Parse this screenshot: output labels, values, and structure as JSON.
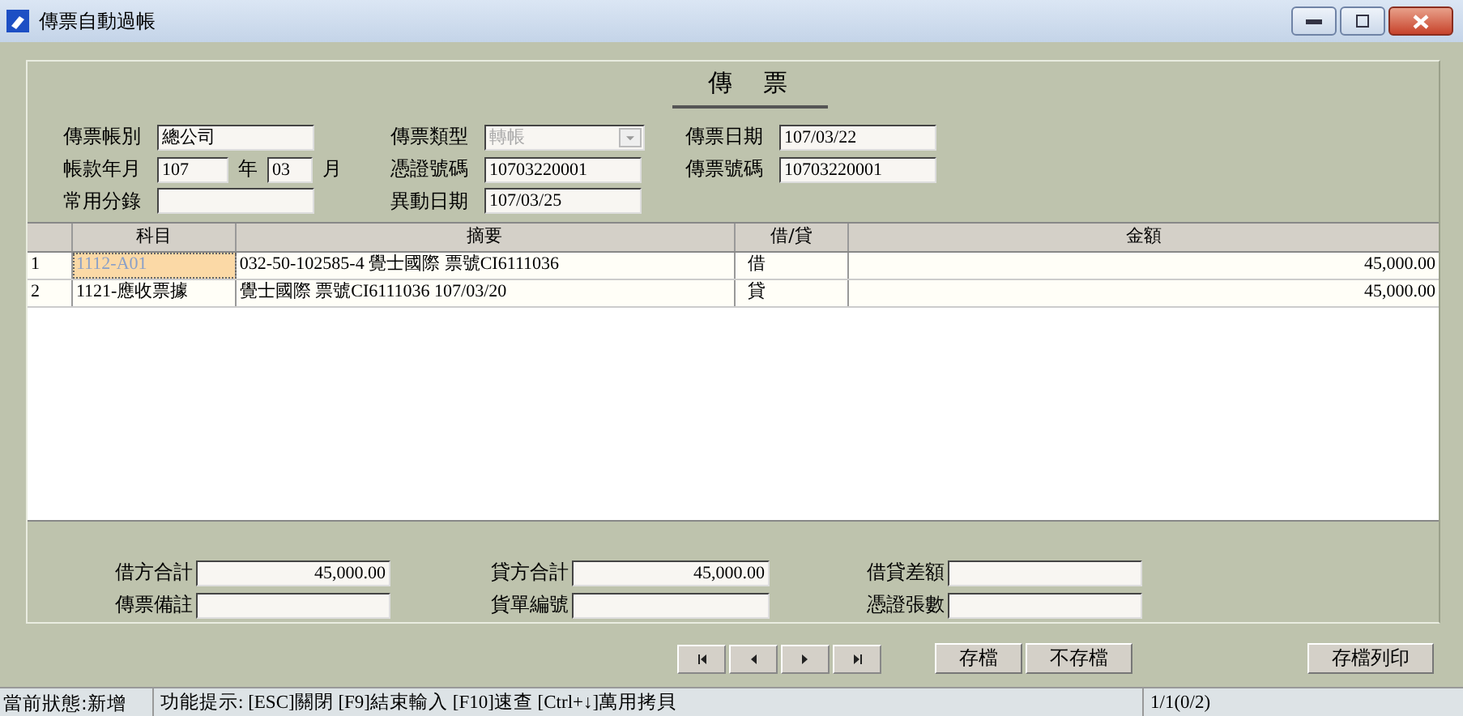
{
  "window": {
    "title": "傳票自動過帳"
  },
  "heading": "傳　票",
  "form": {
    "rows": [
      [
        {
          "kind": "text",
          "label": "傳票帳別",
          "value": "總公司"
        },
        {
          "kind": "dropdown",
          "label": "傳票類型",
          "value": "轉帳",
          "disabled": true
        },
        {
          "kind": "text",
          "label": "傳票日期",
          "value": "107/03/22"
        }
      ],
      [
        {
          "kind": "yearmonth",
          "label": "帳款年月",
          "year": "107",
          "year_suffix": "年",
          "month": "03",
          "month_suffix": "月"
        },
        {
          "kind": "text",
          "label": "憑證號碼",
          "value": "10703220001"
        },
        {
          "kind": "text",
          "label": "傳票號碼",
          "value": "10703220001"
        }
      ],
      [
        {
          "kind": "text",
          "label": "常用分錄"
        },
        {
          "kind": "text",
          "label": "異動日期",
          "value": "107/03/25"
        }
      ]
    ]
  },
  "table": {
    "columns": [
      "科目",
      "摘要",
      "借/貸",
      "金額"
    ],
    "rows": [
      {
        "number": "1",
        "cells": [
          {
            "text": "1112-A01",
            "focused": true
          },
          {
            "text": "032-50-102585-4 覺士國際 票號CI6111036",
            "focused": false
          },
          {
            "text": "借",
            "focused": false
          },
          {
            "text": "45,000.00",
            "focused": false
          }
        ]
      },
      {
        "number": "2",
        "cells": [
          {
            "text": "1121-應收票據",
            "focused": false
          },
          {
            "text": "覺士國際 票號CI6111036 107/03/20",
            "focused": false
          },
          {
            "text": "貸",
            "focused": false
          },
          {
            "text": "45,000.00",
            "focused": false
          }
        ]
      }
    ]
  },
  "totals": {
    "rows": [
      [
        {
          "label": "借方合計",
          "value": "45,000.00"
        },
        {
          "label": "貸方合計",
          "value": "45,000.00"
        },
        {
          "label": "借貸差額"
        }
      ],
      [
        {
          "label": "傳票備註"
        },
        {
          "label": "貨單編號"
        },
        {
          "label": "憑證張數"
        }
      ]
    ]
  },
  "buttons": [
    "存檔",
    "不存檔"
  ],
  "print_button": "存檔列印",
  "status_bar": {
    "state": "當前狀態:新增",
    "hint": "功能提示: [ESC]關閉 [F9]結束輸入 [F10]速查 [Ctrl+↓]萬用拷貝",
    "record": "1/1(0/2)"
  }
}
